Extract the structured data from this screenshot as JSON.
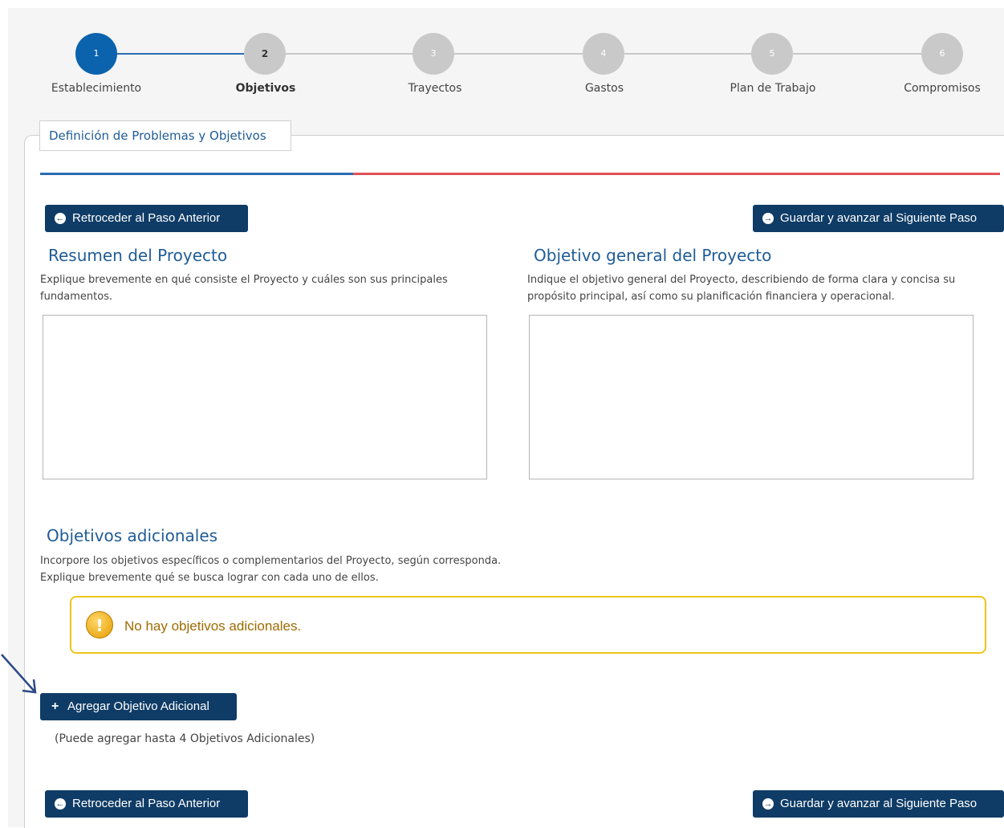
{
  "stepper": {
    "steps": [
      {
        "number": "1",
        "label": "Establecimiento",
        "state": "done"
      },
      {
        "number": "2",
        "label": "Objetivos",
        "state": "current"
      },
      {
        "number": "3",
        "label": "Trayectos",
        "state": "pending"
      },
      {
        "number": "4",
        "label": "Gastos",
        "state": "pending"
      },
      {
        "number": "5",
        "label": "Plan de Trabajo",
        "state": "pending"
      },
      {
        "number": "6",
        "label": "Compromisos",
        "state": "pending"
      }
    ]
  },
  "section": {
    "legend": "Definición de Problemas y Objetivos"
  },
  "nav": {
    "back_label": "Retroceder al Paso Anterior",
    "next_label": "Guardar y avanzar al Siguiente Paso"
  },
  "resumen": {
    "title": "Resumen del Proyecto",
    "description": "Explique brevemente en qué consiste el Proyecto y cuáles son sus principales fundamentos.",
    "value": ""
  },
  "objetivo_general": {
    "title": "Objetivo general del Proyecto",
    "description": "Indique el objetivo general del Proyecto, describiendo de forma clara y concisa su propósito principal, así como su planificación financiera y operacional.",
    "value": ""
  },
  "adicionales": {
    "title": "Objetivos adicionales",
    "description_line1": "Incorpore los objetivos específicos o complementarios del Proyecto, según corresponda.",
    "description_line2": "Explique brevemente qué se busca lograr con cada uno de ellos.",
    "alert_text": "No hay objetivos adicionales.",
    "add_button_label": "Agregar Objetivo Adicional",
    "limit_note": "(Puede agregar hasta 4 Objetivos Adicionales)"
  },
  "colors": {
    "primary_button": "#0f3c66",
    "accent_blue": "#1f5c96",
    "step_done": "#0b63ad",
    "progress_red": "#e05257",
    "alert_border": "#f0c419"
  }
}
